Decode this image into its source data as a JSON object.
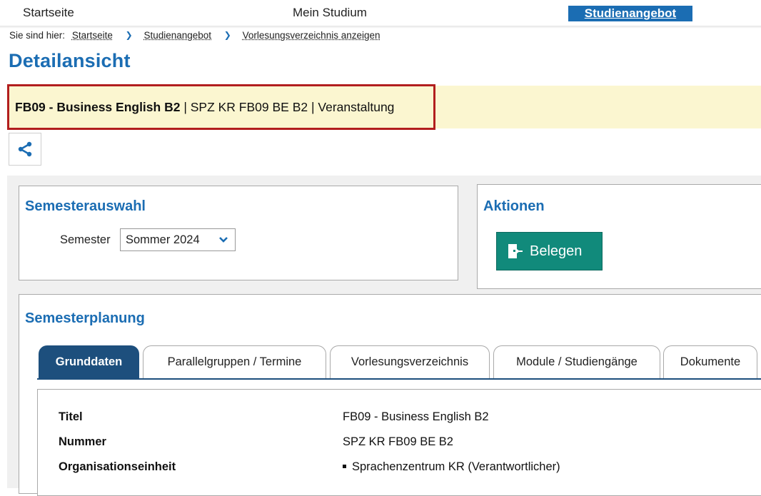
{
  "topnav": {
    "items": [
      "Startseite",
      "Mein Studium",
      "Studienangebot"
    ],
    "active": "Studienangebot"
  },
  "breadcrumb": {
    "label": "Sie sind hier:",
    "items": [
      "Startseite",
      "Studienangebot",
      "Vorlesungsverzeichnis anzeigen"
    ]
  },
  "page_title": "Detailansicht",
  "title_band": {
    "name": "FB09 - Business English B2",
    "separator1": " | ",
    "number": "SPZ KR FB09 BE B2",
    "separator2": " | ",
    "type": "Veranstaltung"
  },
  "share": {
    "icon": "share-icon"
  },
  "semesterauswahl": {
    "heading": "Semesterauswahl",
    "semester_label": "Semester",
    "semester_value": "Sommer 2024"
  },
  "aktionen": {
    "heading": "Aktionen",
    "belegen_label": "Belegen",
    "belegen_icon": "enter-door-icon"
  },
  "semesterplanung": {
    "heading": "Semesterplanung",
    "tabs": [
      "Grunddaten",
      "Parallelgruppen / Termine",
      "Vorlesungsverzeichnis",
      "Module / Studiengänge",
      "Dokumente"
    ],
    "active_tab": "Grunddaten"
  },
  "grunddaten": {
    "rows": [
      {
        "label": "Titel",
        "value": "FB09 - Business English B2"
      },
      {
        "label": "Nummer",
        "value": "SPZ KR FB09 BE B2"
      },
      {
        "label": "Organisationseinheit",
        "value": "Sprachenzentrum KR (Verantwortlicher)"
      }
    ]
  },
  "colors": {
    "accent": "#1b6db3",
    "tab_active": "#1d4f7d",
    "belegen": "#118a7b",
    "title_band": "#fbf6d0",
    "highlight_box": "#b21e1e"
  }
}
